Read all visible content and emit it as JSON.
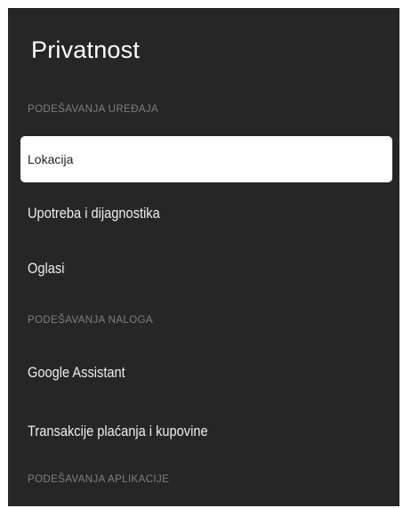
{
  "page": {
    "title": "Privatnost"
  },
  "sections": {
    "device": "PODEŠAVANJA UREĐAJA",
    "account": "PODEŠAVANJA NALOGA",
    "apps": "PODEŠAVANJA APLIKACIJE"
  },
  "items": {
    "location": "Lokacija",
    "usage": "Upotreba i dijagnostika",
    "ads": "Oglasi",
    "assistant": "Google Assistant",
    "payments": "Transakcije plaćanja i kupovine"
  },
  "selected_item": "location",
  "colors": {
    "panel_bg": "#262626",
    "selected_bg": "#ffffff",
    "section_text": "#7f7f7f"
  }
}
